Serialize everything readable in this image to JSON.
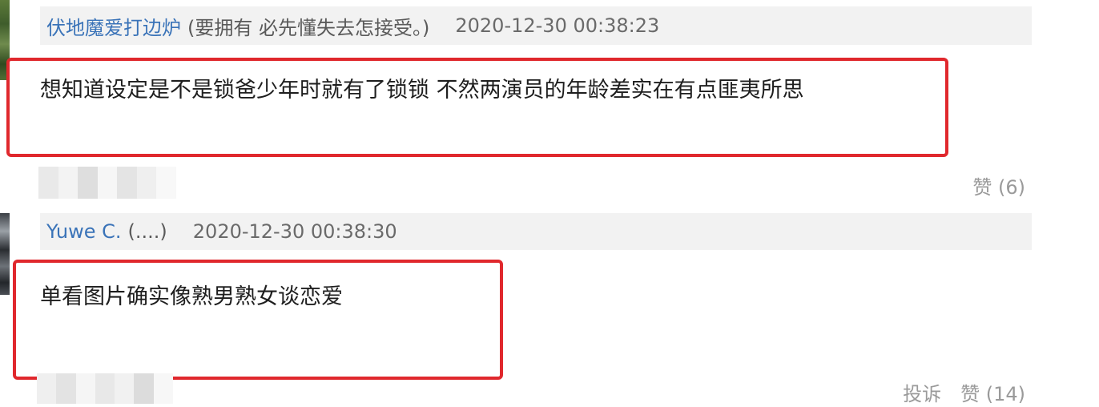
{
  "comments": [
    {
      "username": "伏地魔爱打边炉",
      "user_note": "(要拥有 必先懂失去怎接受。)",
      "timestamp": "2020-12-30 00:38:23",
      "text": "想知道设定是不是锁爸少年时就有了锁锁 不然两演员的年龄差实在有点匪夷所思",
      "like_label": "赞 (6)",
      "report_label": ""
    },
    {
      "username": "Yuwe C.",
      "user_note": "(....)",
      "timestamp": "2020-12-30 00:38:30",
      "text": "单看图片确实像熟男熟女谈恋爱",
      "like_label": "赞 (14)",
      "report_label": "投诉"
    }
  ],
  "colors": {
    "username": "#3a73b8",
    "highlight": "#e0282d",
    "header_bg": "#f2f2f2",
    "muted": "#9a9a9a"
  }
}
